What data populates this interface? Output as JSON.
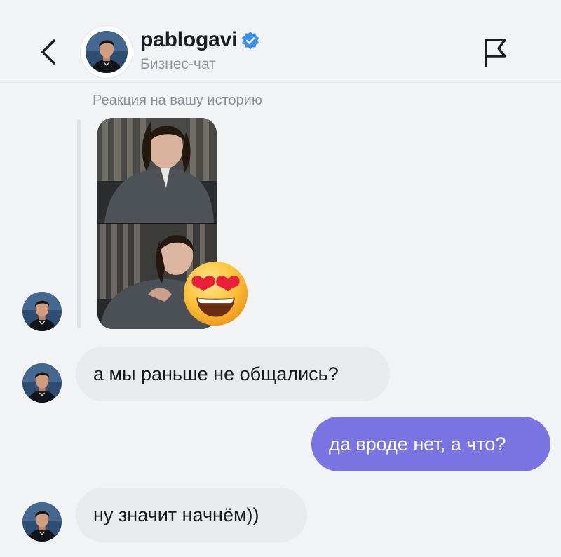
{
  "header": {
    "username": "pablogavi",
    "subtitle": "Бизнес-чат",
    "verified": true,
    "back_icon": "chevron-left-icon",
    "report_icon": "flag-icon"
  },
  "story_reply": {
    "caption": "Реакция на вашу историю",
    "reaction_emoji": "heart-eyes-emoji"
  },
  "messages": [
    {
      "side": "incoming",
      "text": "а мы раньше не общались?"
    },
    {
      "side": "outgoing",
      "text": "да вроде нет, а что?"
    },
    {
      "side": "incoming",
      "text": "ну значит начнём))"
    }
  ],
  "colors": {
    "background": "#f2f3f5",
    "incoming_bubble": "#e8eaee",
    "outgoing_bubble": "#7a74e3",
    "verified_badge": "#3a8ff0"
  }
}
